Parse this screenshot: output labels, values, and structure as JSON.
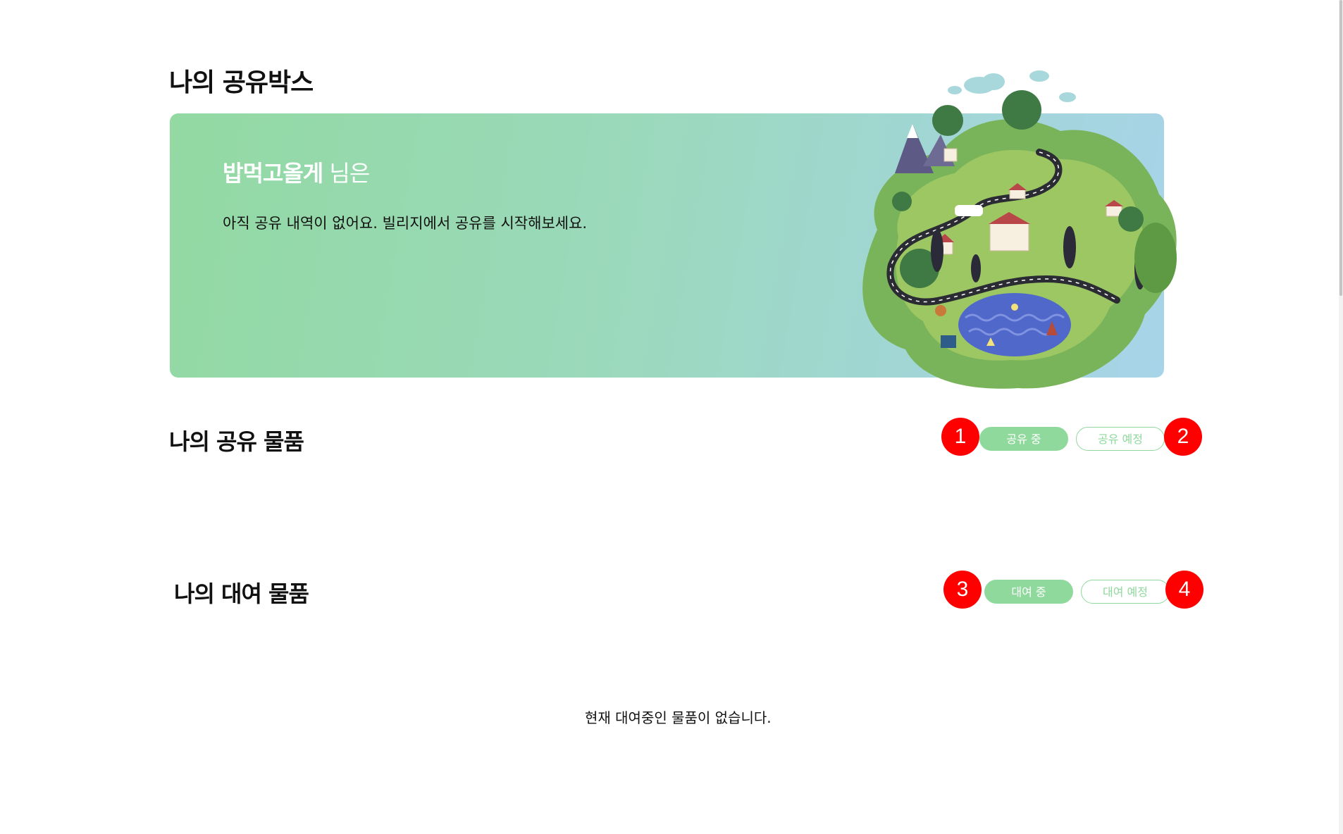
{
  "page": {
    "title": "나의 공유박스"
  },
  "banner": {
    "nickname": "밥먹고올게",
    "honorific": "님은",
    "message": "아직 공유 내역이 없어요. 빌리지에서 공유를 시작해보세요."
  },
  "share_section": {
    "title": "나의 공유 물품",
    "tabs": [
      {
        "label": "공유 중",
        "active": true
      },
      {
        "label": "공유 예정",
        "active": false
      }
    ]
  },
  "rental_section": {
    "title": "나의 대여 물품",
    "tabs": [
      {
        "label": "대여 중",
        "active": true
      },
      {
        "label": "대여 예정",
        "active": false
      }
    ],
    "empty_message": "현재 대여중인 물품이 없습니다."
  },
  "markers": [
    "1",
    "2",
    "3",
    "4"
  ],
  "colors": {
    "accent": "#8fd99d",
    "banner_start": "#92d9a2",
    "banner_end": "#a8d4e9",
    "marker": "#ff0000"
  }
}
